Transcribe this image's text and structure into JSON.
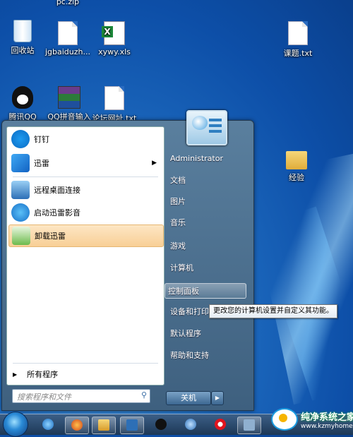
{
  "desktop": {
    "top_cut_label": "pc.zip",
    "icons": [
      {
        "label": "回收站",
        "icon": "recycle-bin-icon"
      },
      {
        "label": "jgbaiduzh...",
        "icon": "document-icon"
      },
      {
        "label": "xywy.xls",
        "icon": "excel-file-icon"
      },
      {
        "label": "课题.txt",
        "icon": "text-file-icon"
      },
      {
        "label": "腾讯QQ",
        "icon": "qq-icon"
      },
      {
        "label": "QQ拼音输入",
        "icon": "winrar-icon"
      },
      {
        "label": "论坛网址.txt",
        "icon": "text-file-icon"
      },
      {
        "label": "经验",
        "icon": "folder-icon"
      }
    ]
  },
  "start_menu": {
    "programs": [
      {
        "label": "钉钉",
        "icon": "dingtalk-icon",
        "submenu": false
      },
      {
        "label": "迅雷",
        "icon": "xunlei-icon",
        "submenu": true
      },
      {
        "label": "远程桌面连接",
        "icon": "remote-desktop-icon",
        "submenu": false
      },
      {
        "label": "启动迅雷影音",
        "icon": "xunlei-player-icon",
        "submenu": false
      },
      {
        "label": "卸载迅雷",
        "icon": "uninstall-icon",
        "submenu": false,
        "selected": true
      }
    ],
    "all_programs": "所有程序",
    "search_placeholder": "搜索程序和文件",
    "user": "Administrator",
    "right_items": [
      "文档",
      "图片",
      "音乐",
      "游戏",
      "计算机",
      "控制面板",
      "设备和打印机",
      "默认程序",
      "帮助和支持"
    ],
    "highlighted_item": "控制面板",
    "shutdown_label": "关机"
  },
  "tooltip": "更改您的计算机设置并自定义其功能。",
  "watermark": {
    "title": "纯净系统之家",
    "url": "www.kzmyhome.com"
  },
  "colors": {
    "desktop": "#1e6bbf",
    "start_menu": "#4a6e8f",
    "selected_item": "#f8cf96"
  }
}
